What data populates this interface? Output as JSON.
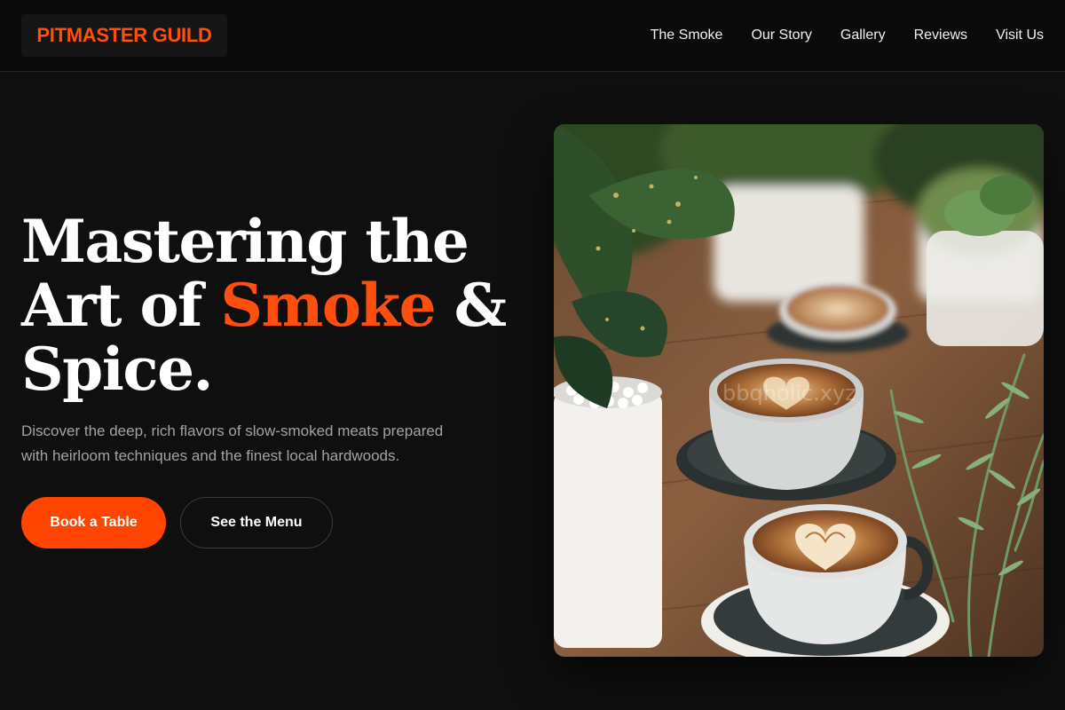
{
  "brand": {
    "name": "PITMASTER GUILD",
    "accent_color": "#ff4f0f"
  },
  "nav": {
    "items": [
      {
        "label": "The Smoke"
      },
      {
        "label": "Our Story"
      },
      {
        "label": "Gallery"
      },
      {
        "label": "Reviews"
      },
      {
        "label": "Visit Us"
      }
    ]
  },
  "hero": {
    "title_part1": "Mastering the Art of ",
    "title_accent": "Smoke",
    "title_part2": " & Spice.",
    "description": "Discover the deep, rich flavors of slow-smoked meats prepared with heirloom techniques and the finest local hardwoods.",
    "primary_cta": "Book a Table",
    "secondary_cta": "See the Menu",
    "image": {
      "subject": "latte cups with heart latte art among potted plants on a wooden table",
      "watermark": "bbqholic.xyz"
    }
  },
  "colors": {
    "background": "#0f0f0f",
    "header_bg": "#0a0a0a",
    "accent": "#ff4500",
    "muted_text": "#a3a3a3"
  }
}
